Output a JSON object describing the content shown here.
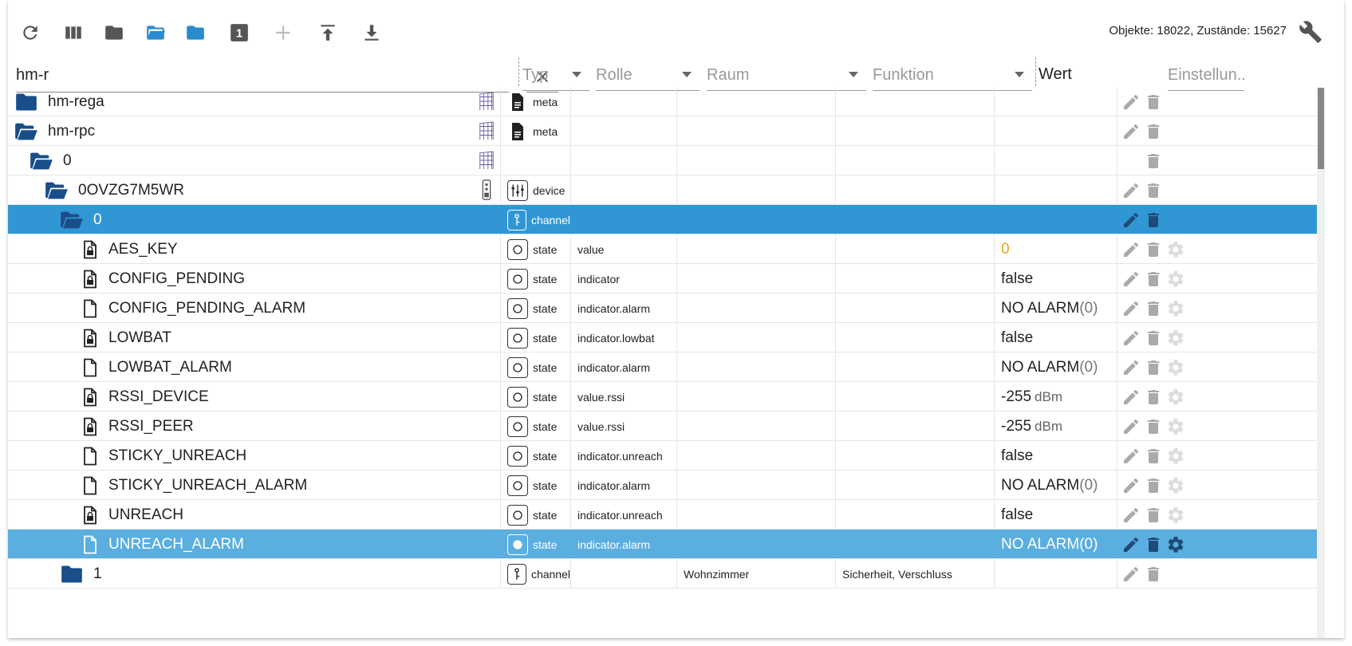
{
  "toolbar": {
    "buttons": [
      {
        "name": "refresh-button",
        "icon": "refresh-icon"
      },
      {
        "name": "columns-button",
        "icon": "columns-icon"
      },
      {
        "name": "collapse-all-button",
        "icon": "folder-icon"
      },
      {
        "name": "expand-all-button",
        "icon": "folder-open-icon"
      },
      {
        "name": "expand-one-button",
        "icon": "folder-icon"
      },
      {
        "name": "level-button",
        "icon": "one-badge-icon",
        "text": "1"
      },
      {
        "name": "add-button",
        "icon": "plus-icon"
      },
      {
        "name": "upload-button",
        "icon": "upload-icon"
      },
      {
        "name": "download-button",
        "icon": "download-icon"
      }
    ],
    "stats": "Objekte: 18022, Zustände: 15627"
  },
  "filters": {
    "search_value": "hm-r",
    "typ": "Typ",
    "rolle": "Rolle",
    "raum": "Raum",
    "funktion": "Funktion",
    "wert": "Wert",
    "einstellungen": "Einstellun.."
  },
  "colors": {
    "folder": "#1a4e8a",
    "selected_row": "#3197d4",
    "selected_row_2": "#5aaee0",
    "value_number": "#f0a020"
  },
  "rows": [
    {
      "name": "hm-rega",
      "level": 0,
      "icon": "folder",
      "typ": "meta",
      "typ_icon": "file",
      "rolle": "",
      "raum": "",
      "funktion": "",
      "wert": "",
      "edit": true,
      "delete": true,
      "gear": false,
      "side": "adapter"
    },
    {
      "name": "hm-rpc",
      "level": 0,
      "icon": "folder-open",
      "typ": "meta",
      "typ_icon": "file",
      "rolle": "",
      "raum": "",
      "funktion": "",
      "wert": "",
      "edit": true,
      "delete": true,
      "gear": false,
      "side": "adapter"
    },
    {
      "name": "0",
      "level": 1,
      "icon": "folder-open",
      "typ": "",
      "typ_icon": "",
      "rolle": "",
      "raum": "",
      "funktion": "",
      "wert": "",
      "edit": false,
      "delete": true,
      "gear": false,
      "side": "adapter"
    },
    {
      "name": "0OVZG7M5WR",
      "level": 2,
      "icon": "folder-open",
      "typ": "device",
      "typ_icon": "device",
      "rolle": "",
      "raum": "",
      "funktion": "",
      "wert": "",
      "edit": true,
      "delete": true,
      "gear": false,
      "side": "device"
    },
    {
      "name": "0",
      "level": 3,
      "icon": "folder-open",
      "typ": "channel",
      "typ_icon": "channel",
      "rolle": "",
      "raum": "",
      "funktion": "",
      "wert": "",
      "edit": true,
      "delete": true,
      "gear": false,
      "selected": 1
    },
    {
      "name": "AES_KEY",
      "level": 4,
      "icon": "file-lock",
      "typ": "state",
      "typ_icon": "state",
      "rolle": "value",
      "raum": "",
      "funktion": "",
      "wert": "0",
      "wert_style": "number",
      "edit": true,
      "delete": true,
      "gear": true
    },
    {
      "name": "CONFIG_PENDING",
      "level": 4,
      "icon": "file-lock",
      "typ": "state",
      "typ_icon": "state",
      "rolle": "indicator",
      "raum": "",
      "funktion": "",
      "wert": "false",
      "edit": true,
      "delete": true,
      "gear": true
    },
    {
      "name": "CONFIG_PENDING_ALARM",
      "level": 4,
      "icon": "file",
      "typ": "state",
      "typ_icon": "state",
      "rolle": "indicator.alarm",
      "raum": "",
      "funktion": "",
      "wert": "NO ALARM",
      "wert_suffix": "(0)",
      "edit": true,
      "delete": true,
      "gear": true
    },
    {
      "name": "LOWBAT",
      "level": 4,
      "icon": "file-lock",
      "typ": "state",
      "typ_icon": "state",
      "rolle": "indicator.lowbat",
      "raum": "",
      "funktion": "",
      "wert": "false",
      "edit": true,
      "delete": true,
      "gear": true
    },
    {
      "name": "LOWBAT_ALARM",
      "level": 4,
      "icon": "file",
      "typ": "state",
      "typ_icon": "state",
      "rolle": "indicator.alarm",
      "raum": "",
      "funktion": "",
      "wert": "NO ALARM",
      "wert_suffix": "(0)",
      "edit": true,
      "delete": true,
      "gear": true
    },
    {
      "name": "RSSI_DEVICE",
      "level": 4,
      "icon": "file-lock",
      "typ": "state",
      "typ_icon": "state",
      "rolle": "value.rssi",
      "raum": "",
      "funktion": "",
      "wert": "-255",
      "wert_unit": "dBm",
      "edit": true,
      "delete": true,
      "gear": true
    },
    {
      "name": "RSSI_PEER",
      "level": 4,
      "icon": "file-lock",
      "typ": "state",
      "typ_icon": "state",
      "rolle": "value.rssi",
      "raum": "",
      "funktion": "",
      "wert": "-255",
      "wert_unit": "dBm",
      "edit": true,
      "delete": true,
      "gear": true
    },
    {
      "name": "STICKY_UNREACH",
      "level": 4,
      "icon": "file",
      "typ": "state",
      "typ_icon": "state",
      "rolle": "indicator.unreach",
      "raum": "",
      "funktion": "",
      "wert": "false",
      "edit": true,
      "delete": true,
      "gear": true
    },
    {
      "name": "STICKY_UNREACH_ALARM",
      "level": 4,
      "icon": "file",
      "typ": "state",
      "typ_icon": "state",
      "rolle": "indicator.alarm",
      "raum": "",
      "funktion": "",
      "wert": "NO ALARM",
      "wert_suffix": "(0)",
      "edit": true,
      "delete": true,
      "gear": true
    },
    {
      "name": "UNREACH",
      "level": 4,
      "icon": "file-lock",
      "typ": "state",
      "typ_icon": "state",
      "rolle": "indicator.unreach",
      "raum": "",
      "funktion": "",
      "wert": "false",
      "edit": true,
      "delete": true,
      "gear": true
    },
    {
      "name": "UNREACH_ALARM",
      "level": 4,
      "icon": "file",
      "typ": "state",
      "typ_icon": "state",
      "rolle": "indicator.alarm",
      "raum": "",
      "funktion": "",
      "wert": "NO ALARM",
      "wert_suffix": "(0)",
      "edit": true,
      "delete": true,
      "gear": true,
      "selected": 2
    },
    {
      "name": "1",
      "level": 3,
      "icon": "folder",
      "typ": "channel",
      "typ_icon": "channel",
      "rolle": "",
      "raum": "Wohnzimmer",
      "funktion": "Sicherheit, Verschluss",
      "wert": "",
      "edit": true,
      "delete": true,
      "gear": false
    }
  ]
}
